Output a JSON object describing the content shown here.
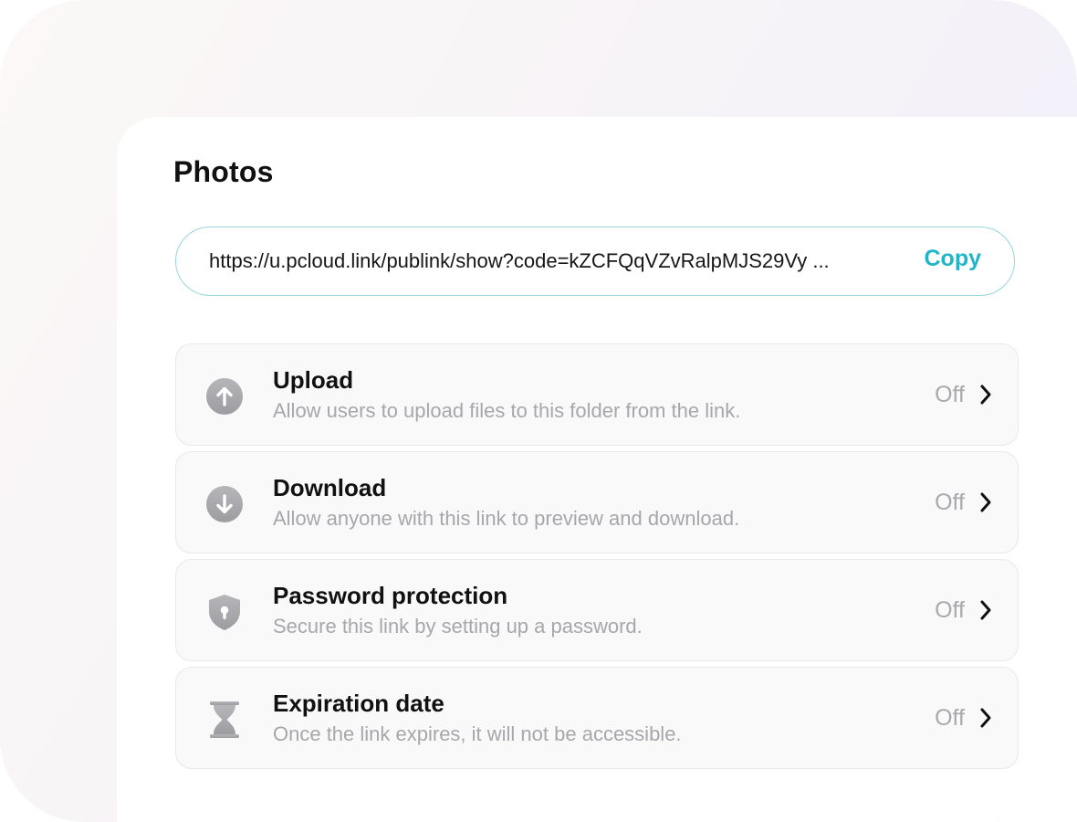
{
  "folder_title": "Photos",
  "link": {
    "url": "https://u.pcloud.link/publink/show?code=kZCFQqVZvRalpMJS29Vy ...",
    "copy_label": "Copy"
  },
  "colors": {
    "accent": "#22b5c7",
    "link_border": "#96d6dc",
    "icon_gray": "#a9a9ae"
  },
  "options": [
    {
      "icon": "upload-icon",
      "label": "Upload",
      "description": "Allow users to upload files to this folder from the link.",
      "status": "Off"
    },
    {
      "icon": "download-icon",
      "label": "Download",
      "description": "Allow anyone with this link to preview and download.",
      "status": "Off"
    },
    {
      "icon": "shield-lock-icon",
      "label": "Password protection",
      "description": "Secure this link by setting up a password.",
      "status": "Off"
    },
    {
      "icon": "hourglass-icon",
      "label": "Expiration date",
      "description": "Once the link expires, it will not be accessible.",
      "status": "Off"
    }
  ]
}
